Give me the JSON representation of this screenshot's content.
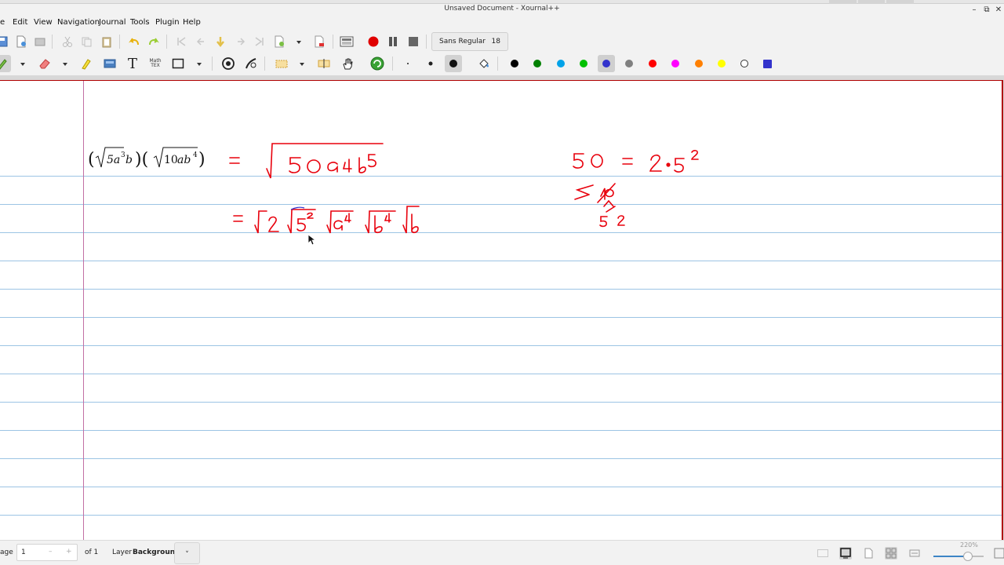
{
  "window": {
    "title": "Unsaved Document - Xournal++"
  },
  "menu": [
    "e",
    "Edit",
    "View",
    "Navigation",
    "Journal",
    "Tools",
    "Plugin",
    "Help"
  ],
  "font_selector": {
    "name": "Sans Regular",
    "size": "18"
  },
  "text_tool_label": "T",
  "math_tool_label": "Math\nTEX",
  "palette": [
    {
      "name": "black",
      "hex": "#000000"
    },
    {
      "name": "green",
      "hex": "#008000"
    },
    {
      "name": "light-blue",
      "hex": "#00a2e8"
    },
    {
      "name": "lime",
      "hex": "#00c000"
    },
    {
      "name": "blue",
      "hex": "#3333cc"
    },
    {
      "name": "gray",
      "hex": "#808080"
    },
    {
      "name": "red",
      "hex": "#ff0000"
    },
    {
      "name": "magenta",
      "hex": "#ff00ff"
    },
    {
      "name": "orange",
      "hex": "#ff8000"
    },
    {
      "name": "yellow",
      "hex": "#ffff00"
    },
    {
      "name": "white",
      "hex": "#ffffff"
    },
    {
      "name": "custom-blue",
      "hex": "#3333cc"
    }
  ],
  "accent_colors": {
    "ink": "#e8000c",
    "record": "#e00000",
    "margin": "#c26fa4",
    "rule": "#9cc4e4"
  },
  "canvas": {
    "typeset_expression": "(√5a³b)(√10ab⁴)",
    "handwriting_line1": "= √50a⁴b⁵",
    "handwriting_line2": "= √2 √5² √a⁴ √b⁴ √b",
    "side_note": "50 = 2·5²"
  },
  "status": {
    "page_label": "age",
    "page_value": "1",
    "page_minus": "–",
    "page_plus": "+",
    "page_of": "of 1",
    "layer_label": "Layer",
    "layer_value": "Background",
    "layer_chevron": "˅",
    "zoom": "220%",
    "zoom_fraction": 0.6
  }
}
